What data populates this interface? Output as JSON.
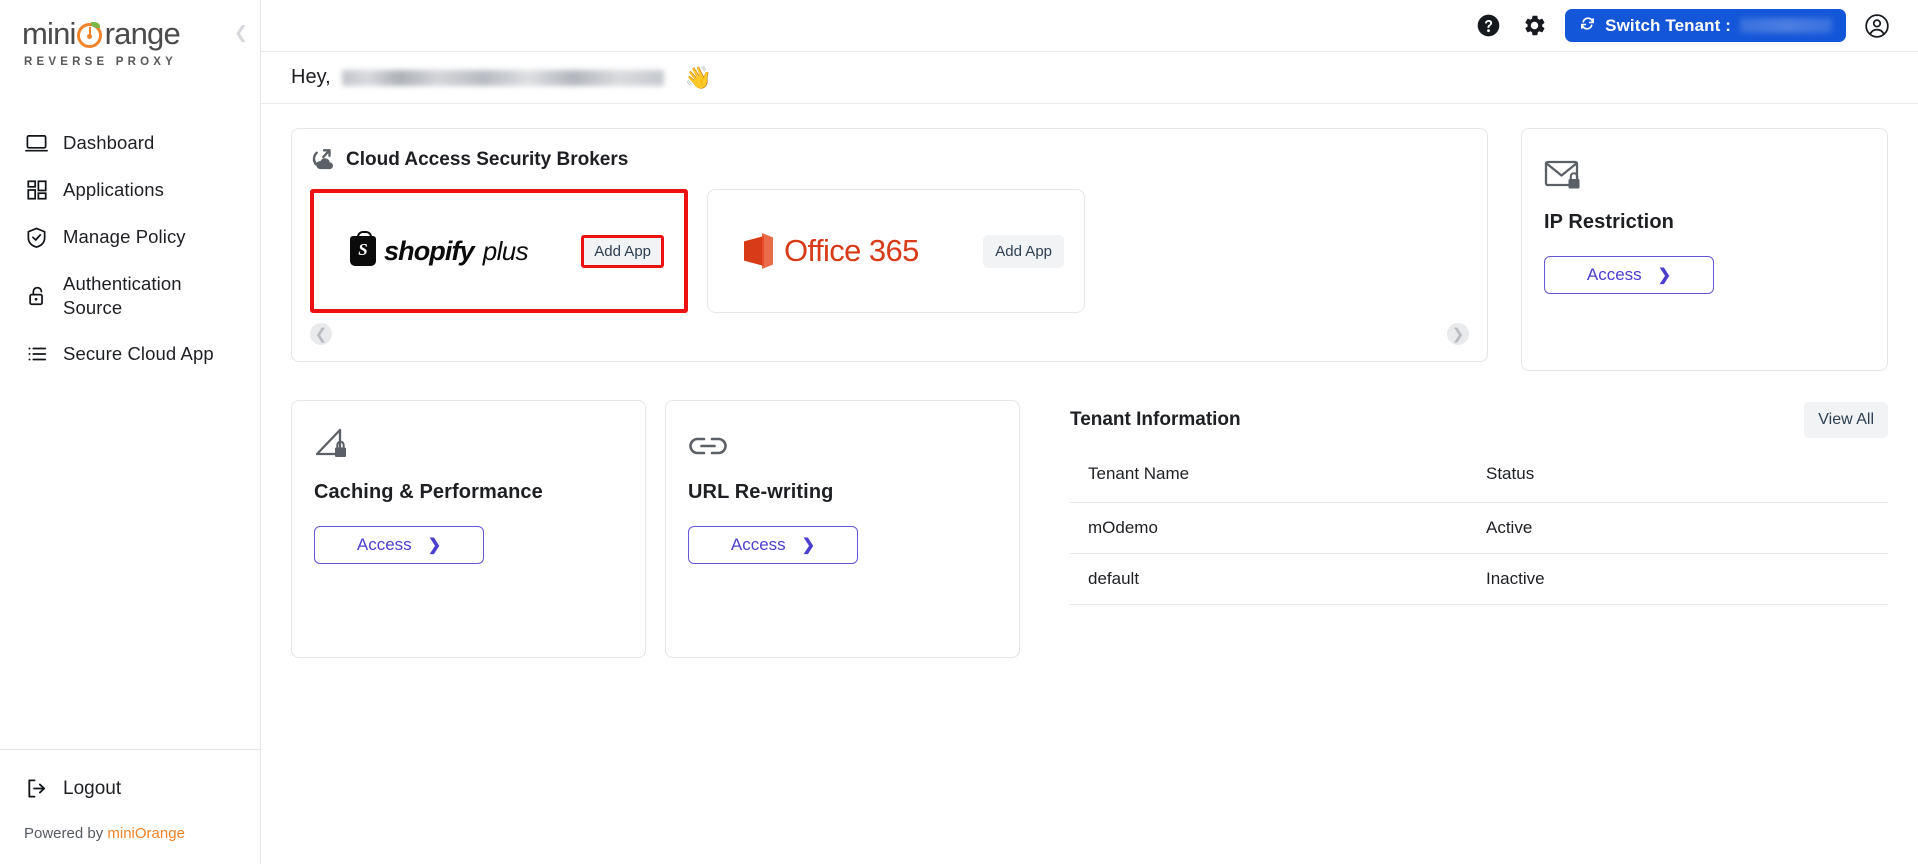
{
  "sidebar": {
    "brand": {
      "name_part1": "mini",
      "name_part2": "range",
      "subtitle": "REVERSE PROXY"
    },
    "collapse_icon": "chevron-left-icon",
    "items": [
      {
        "label": "Dashboard",
        "icon": "monitor-icon"
      },
      {
        "label": "Applications",
        "icon": "grid-icon"
      },
      {
        "label": "Manage Policy",
        "icon": "shield-check-icon"
      },
      {
        "label": "Authentication Source",
        "icon": "unlock-icon"
      },
      {
        "label": "Secure Cloud App",
        "icon": "list-icon"
      }
    ],
    "logout": {
      "label": "Logout",
      "icon": "logout-icon"
    },
    "powered_by": {
      "prefix": "Powered by ",
      "brand": "miniOrange"
    }
  },
  "topbar": {
    "help_icon": "help-circle-icon",
    "settings_icon": "gear-icon",
    "switch_tenant": {
      "label": "Switch Tenant :",
      "icon": "refresh-icon",
      "value_redacted": true
    },
    "account_icon": "user-circle-icon"
  },
  "greeting": {
    "prefix": "Hey,",
    "user_redacted": true,
    "emoji": "👋"
  },
  "casb": {
    "title": "Cloud Access Security Brokers",
    "icon": "cloud-access-icon",
    "apps": [
      {
        "name": "shopifyplus",
        "brand_primary": "shopify",
        "brand_secondary": "plus",
        "button_label": "Add App",
        "highlighted": true
      },
      {
        "name": "Office 365",
        "brand_primary": "Office",
        "brand_secondary": "365",
        "button_label": "Add App",
        "highlighted": false
      }
    ],
    "prev_icon": "chevron-left-circle-icon",
    "next_icon": "chevron-right-circle-icon"
  },
  "ip_restriction": {
    "title": "IP Restriction",
    "icon": "mail-lock-icon",
    "button_label": "Access"
  },
  "feature_cards": [
    {
      "title": "Caching & Performance",
      "icon": "speed-lock-icon",
      "button_label": "Access"
    },
    {
      "title": "URL Re-writing",
      "icon": "link-icon",
      "button_label": "Access"
    }
  ],
  "tenant_information": {
    "title": "Tenant Information",
    "view_all_label": "View All",
    "columns": [
      "Tenant Name",
      "Status"
    ],
    "rows": [
      {
        "name": "mOdemo",
        "status": "Active",
        "status_state": "active"
      },
      {
        "name": "default",
        "status": "Inactive",
        "status_state": "inactive"
      }
    ]
  },
  "colors": {
    "brand_orange": "#f0822a",
    "primary_blue": "#1356d8",
    "accent_indigo": "#4b3fd0",
    "highlight_red": "#ee1111",
    "status_active": "#189c4e",
    "status_inactive": "#e0383a"
  }
}
